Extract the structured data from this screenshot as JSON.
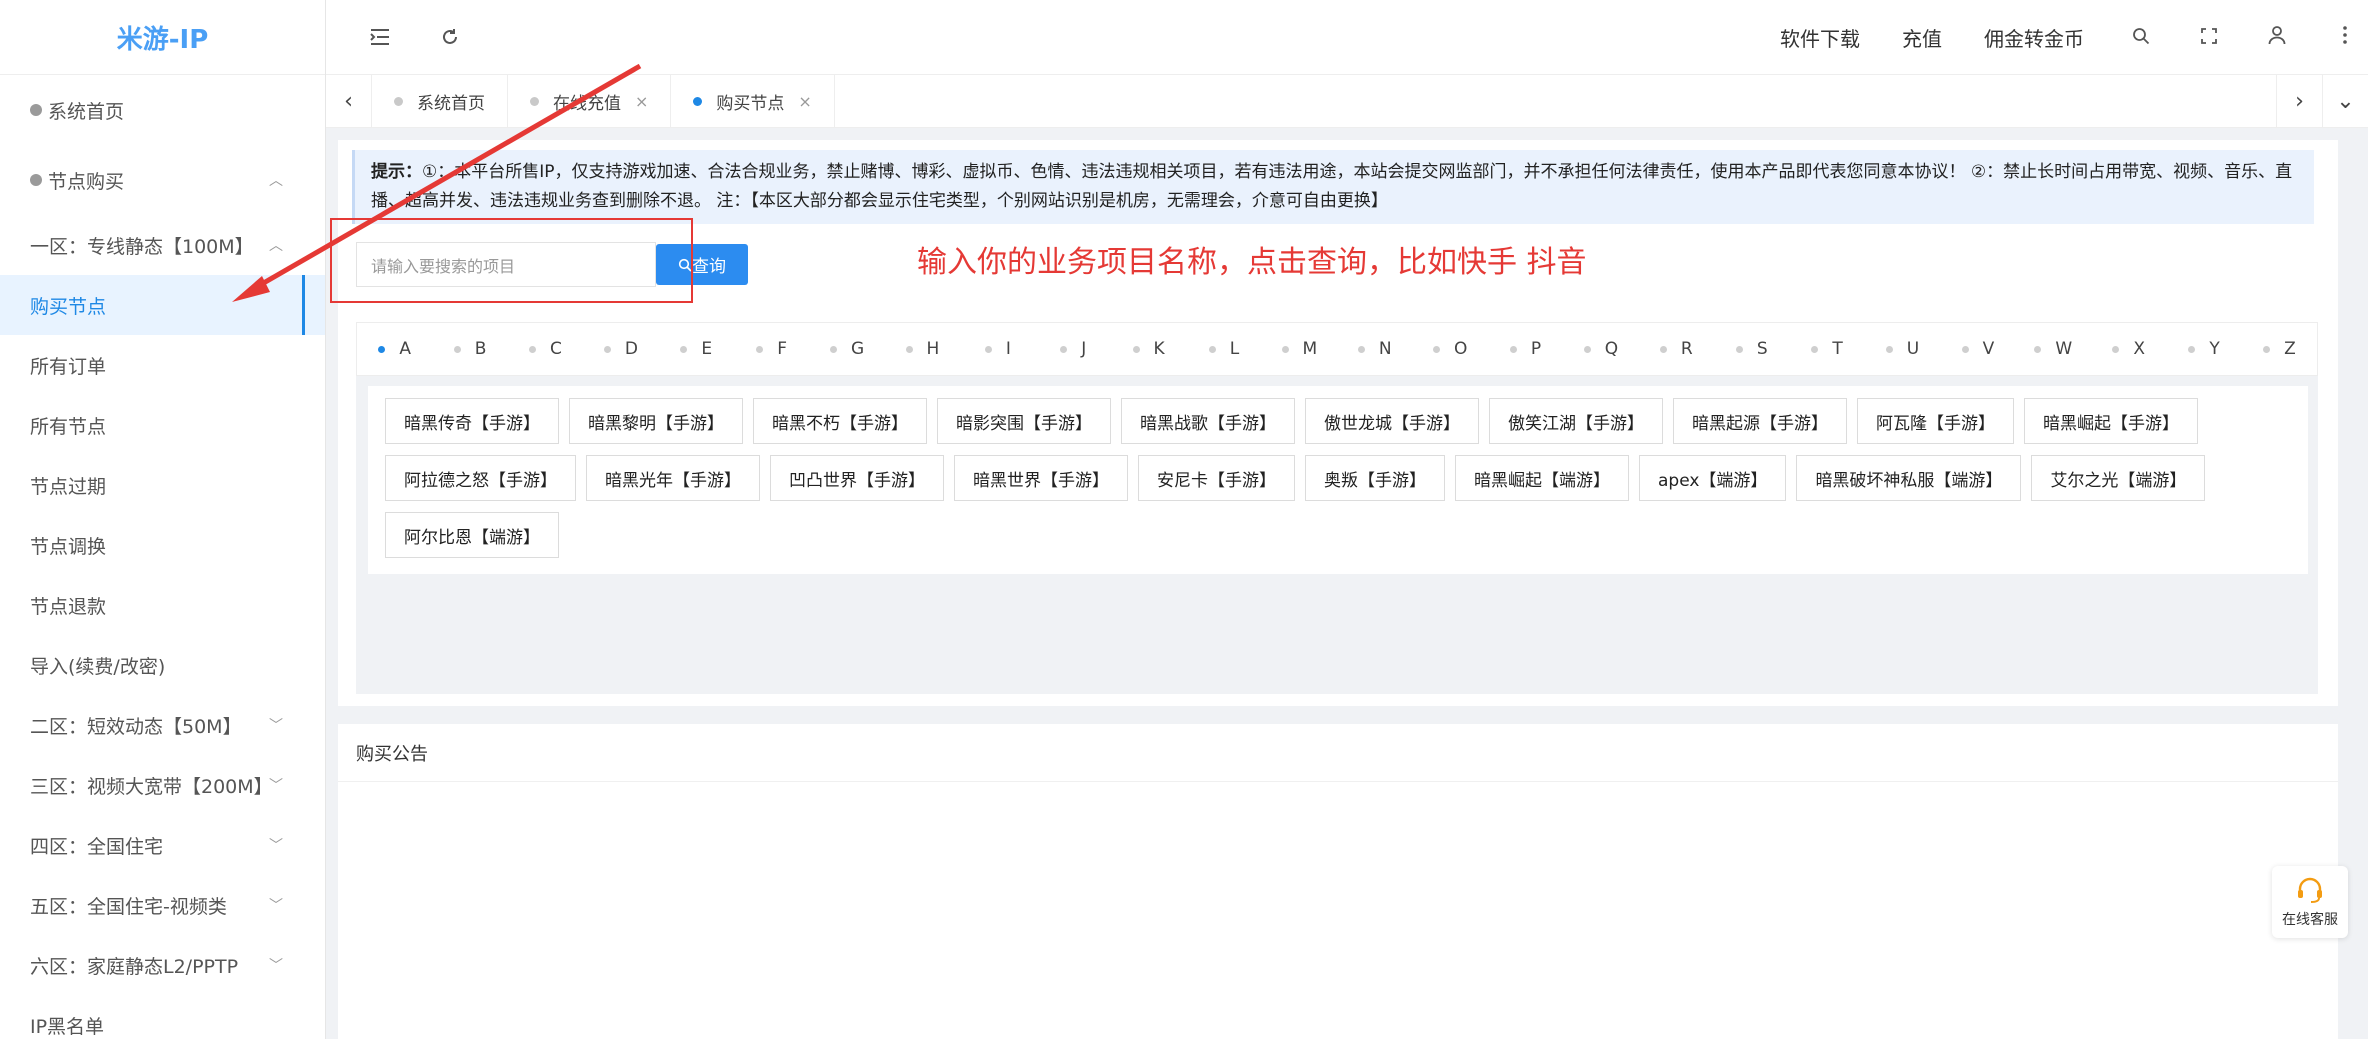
{
  "app": {
    "logo": "米游-IP"
  },
  "sidebar": {
    "items": [
      {
        "label": "系统首页",
        "top": true,
        "dot": true
      },
      {
        "label": "节点购买",
        "top": true,
        "dot": true,
        "chev": "︿"
      },
      {
        "label": "一区：专线静态【100M】",
        "chev": "︿"
      },
      {
        "label": "购买节点",
        "active": true
      },
      {
        "label": "所有订单"
      },
      {
        "label": "所有节点"
      },
      {
        "label": "节点过期"
      },
      {
        "label": "节点调换"
      },
      {
        "label": "节点退款"
      },
      {
        "label": "导入(续费/改密)"
      },
      {
        "label": "二区：短效动态【50M】",
        "chev": "﹀"
      },
      {
        "label": "三区：视频大宽带【200M】",
        "chev": "﹀"
      },
      {
        "label": "四区：全国住宅",
        "chev": "﹀"
      },
      {
        "label": "五区：全国住宅-视频类",
        "chev": "﹀"
      },
      {
        "label": "六区：家庭静态L2/PPTP",
        "chev": "﹀"
      },
      {
        "label": "IP黑名单"
      }
    ]
  },
  "header": {
    "links": [
      "软件下载",
      "充值",
      "佣金转金币"
    ]
  },
  "tabs": [
    {
      "label": "系统首页",
      "closable": false,
      "active": false
    },
    {
      "label": "在线充值",
      "closable": true,
      "active": false
    },
    {
      "label": "购买节点",
      "closable": true,
      "active": true
    }
  ],
  "notice": {
    "prefix": "提示：",
    "text": "①：本平台所售IP，仅支持游戏加速、合法合规业务，禁止赌博、博彩、虚拟币、色情、违法违规相关项目，若有违法用途，本站会提交网监部门，并不承担任何法律责任，使用本产品即代表您同意本协议！ ②：禁止长时间占用带宽、视频、音乐、直播、超高并发、违法违规业务查到删除不退。 注：【本区大部分都会显示住宅类型，个别网站识别是机房，无需理会，介意可自由更换】"
  },
  "search": {
    "placeholder": "请输入要搜索的项目",
    "button": "查询"
  },
  "annotation": "输入你的业务项目名称，点击查询，比如快手 抖音",
  "letters": [
    "A",
    "B",
    "C",
    "D",
    "E",
    "F",
    "G",
    "H",
    "I",
    "J",
    "K",
    "L",
    "M",
    "N",
    "O",
    "P",
    "Q",
    "R",
    "S",
    "T",
    "U",
    "V",
    "W",
    "X",
    "Y",
    "Z"
  ],
  "items": [
    "暗黑传奇【手游】",
    "暗黑黎明【手游】",
    "暗黑不朽【手游】",
    "暗影突围【手游】",
    "暗黑战歌【手游】",
    "傲世龙城【手游】",
    "傲笑江湖【手游】",
    "暗黑起源【手游】",
    "阿瓦隆【手游】",
    "暗黑崛起【手游】",
    "阿拉德之怒【手游】",
    "暗黑光年【手游】",
    "凹凸世界【手游】",
    "暗黑世界【手游】",
    "安尼卡【手游】",
    "奥叛【手游】",
    "暗黑崛起【端游】",
    "apex【端游】",
    "暗黑破坏神私服【端游】",
    "艾尔之光【端游】",
    "阿尔比恩【端游】"
  ],
  "announcement": {
    "title": "购买公告"
  },
  "support": {
    "label": "在线客服"
  },
  "colors": {
    "accent": "#1e88e5",
    "annotation": "#e53935",
    "button": "#2c8cf0",
    "logo": "#4a9ff5"
  }
}
